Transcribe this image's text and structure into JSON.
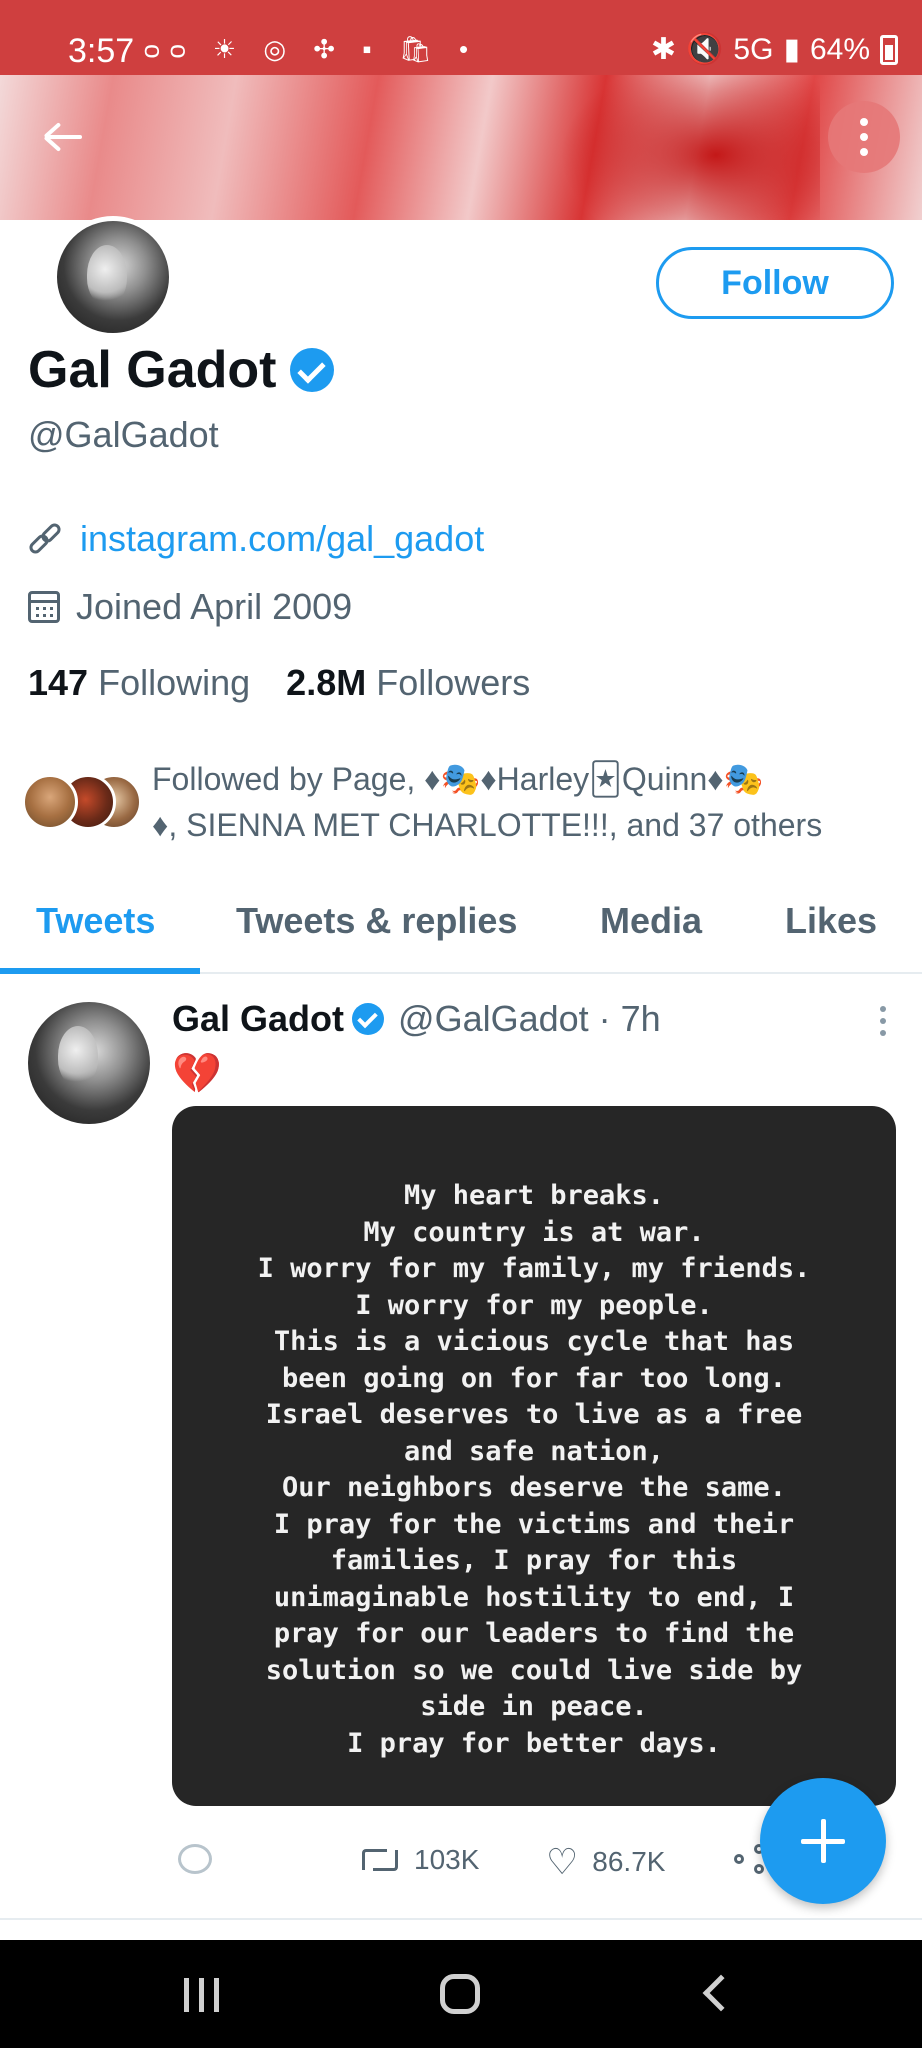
{
  "status_bar": {
    "time": "3:57",
    "left_icons": "ᴑᴑ ☀ ◎ ✣ ▪ 🛍 •",
    "network": "5G",
    "battery": "64%"
  },
  "profile": {
    "follow_label": "Follow",
    "display_name": "Gal Gadot",
    "handle": "@GalGadot",
    "link": "instagram.com/gal_gadot",
    "joined": "Joined April 2009",
    "following_count": "147",
    "following_label": "Following",
    "followers_count": "2.8M",
    "followers_label": "Followers",
    "followed_by_line1": "Followed by Page, ♦🎭♦Harley🃏Quinn♦🎭",
    "followed_by_line2": "♦, SIENNA MET CHARLOTTE!!!, and 37 others"
  },
  "tabs": [
    {
      "label": "Tweets"
    },
    {
      "label": "Tweets & replies"
    },
    {
      "label": "Media"
    },
    {
      "label": "Likes"
    }
  ],
  "tweet": {
    "name": "Gal Gadot",
    "handle_time": "@GalGadot · 7h",
    "emoji": "💔",
    "image_text": "My heart breaks.\nMy country is at war.\nI worry for my family, my friends.\nI worry for my people.\nThis is a vicious cycle that has\nbeen going on for far too long.\nIsrael deserves to live as a free\nand safe nation,\nOur neighbors deserve the same.\nI pray for the victims and their\nfamilies, I pray for this\nunimaginable hostility to end, I\npray for our leaders to find the\nsolution so we could live side by\nside in peace.\nI pray for better days.",
    "retweets": "103K",
    "likes": "86.7K"
  },
  "colors": {
    "accent": "#1d9bf0",
    "status_bar": "#cf3f3f",
    "secondary_text": "#536471"
  },
  "icons": [
    "back-arrow-icon",
    "more-vertical-icon",
    "verified-icon",
    "link-icon",
    "calendar-icon",
    "reply-icon",
    "retweet-icon",
    "heart-icon",
    "share-icon",
    "compose-plus-icon"
  ]
}
